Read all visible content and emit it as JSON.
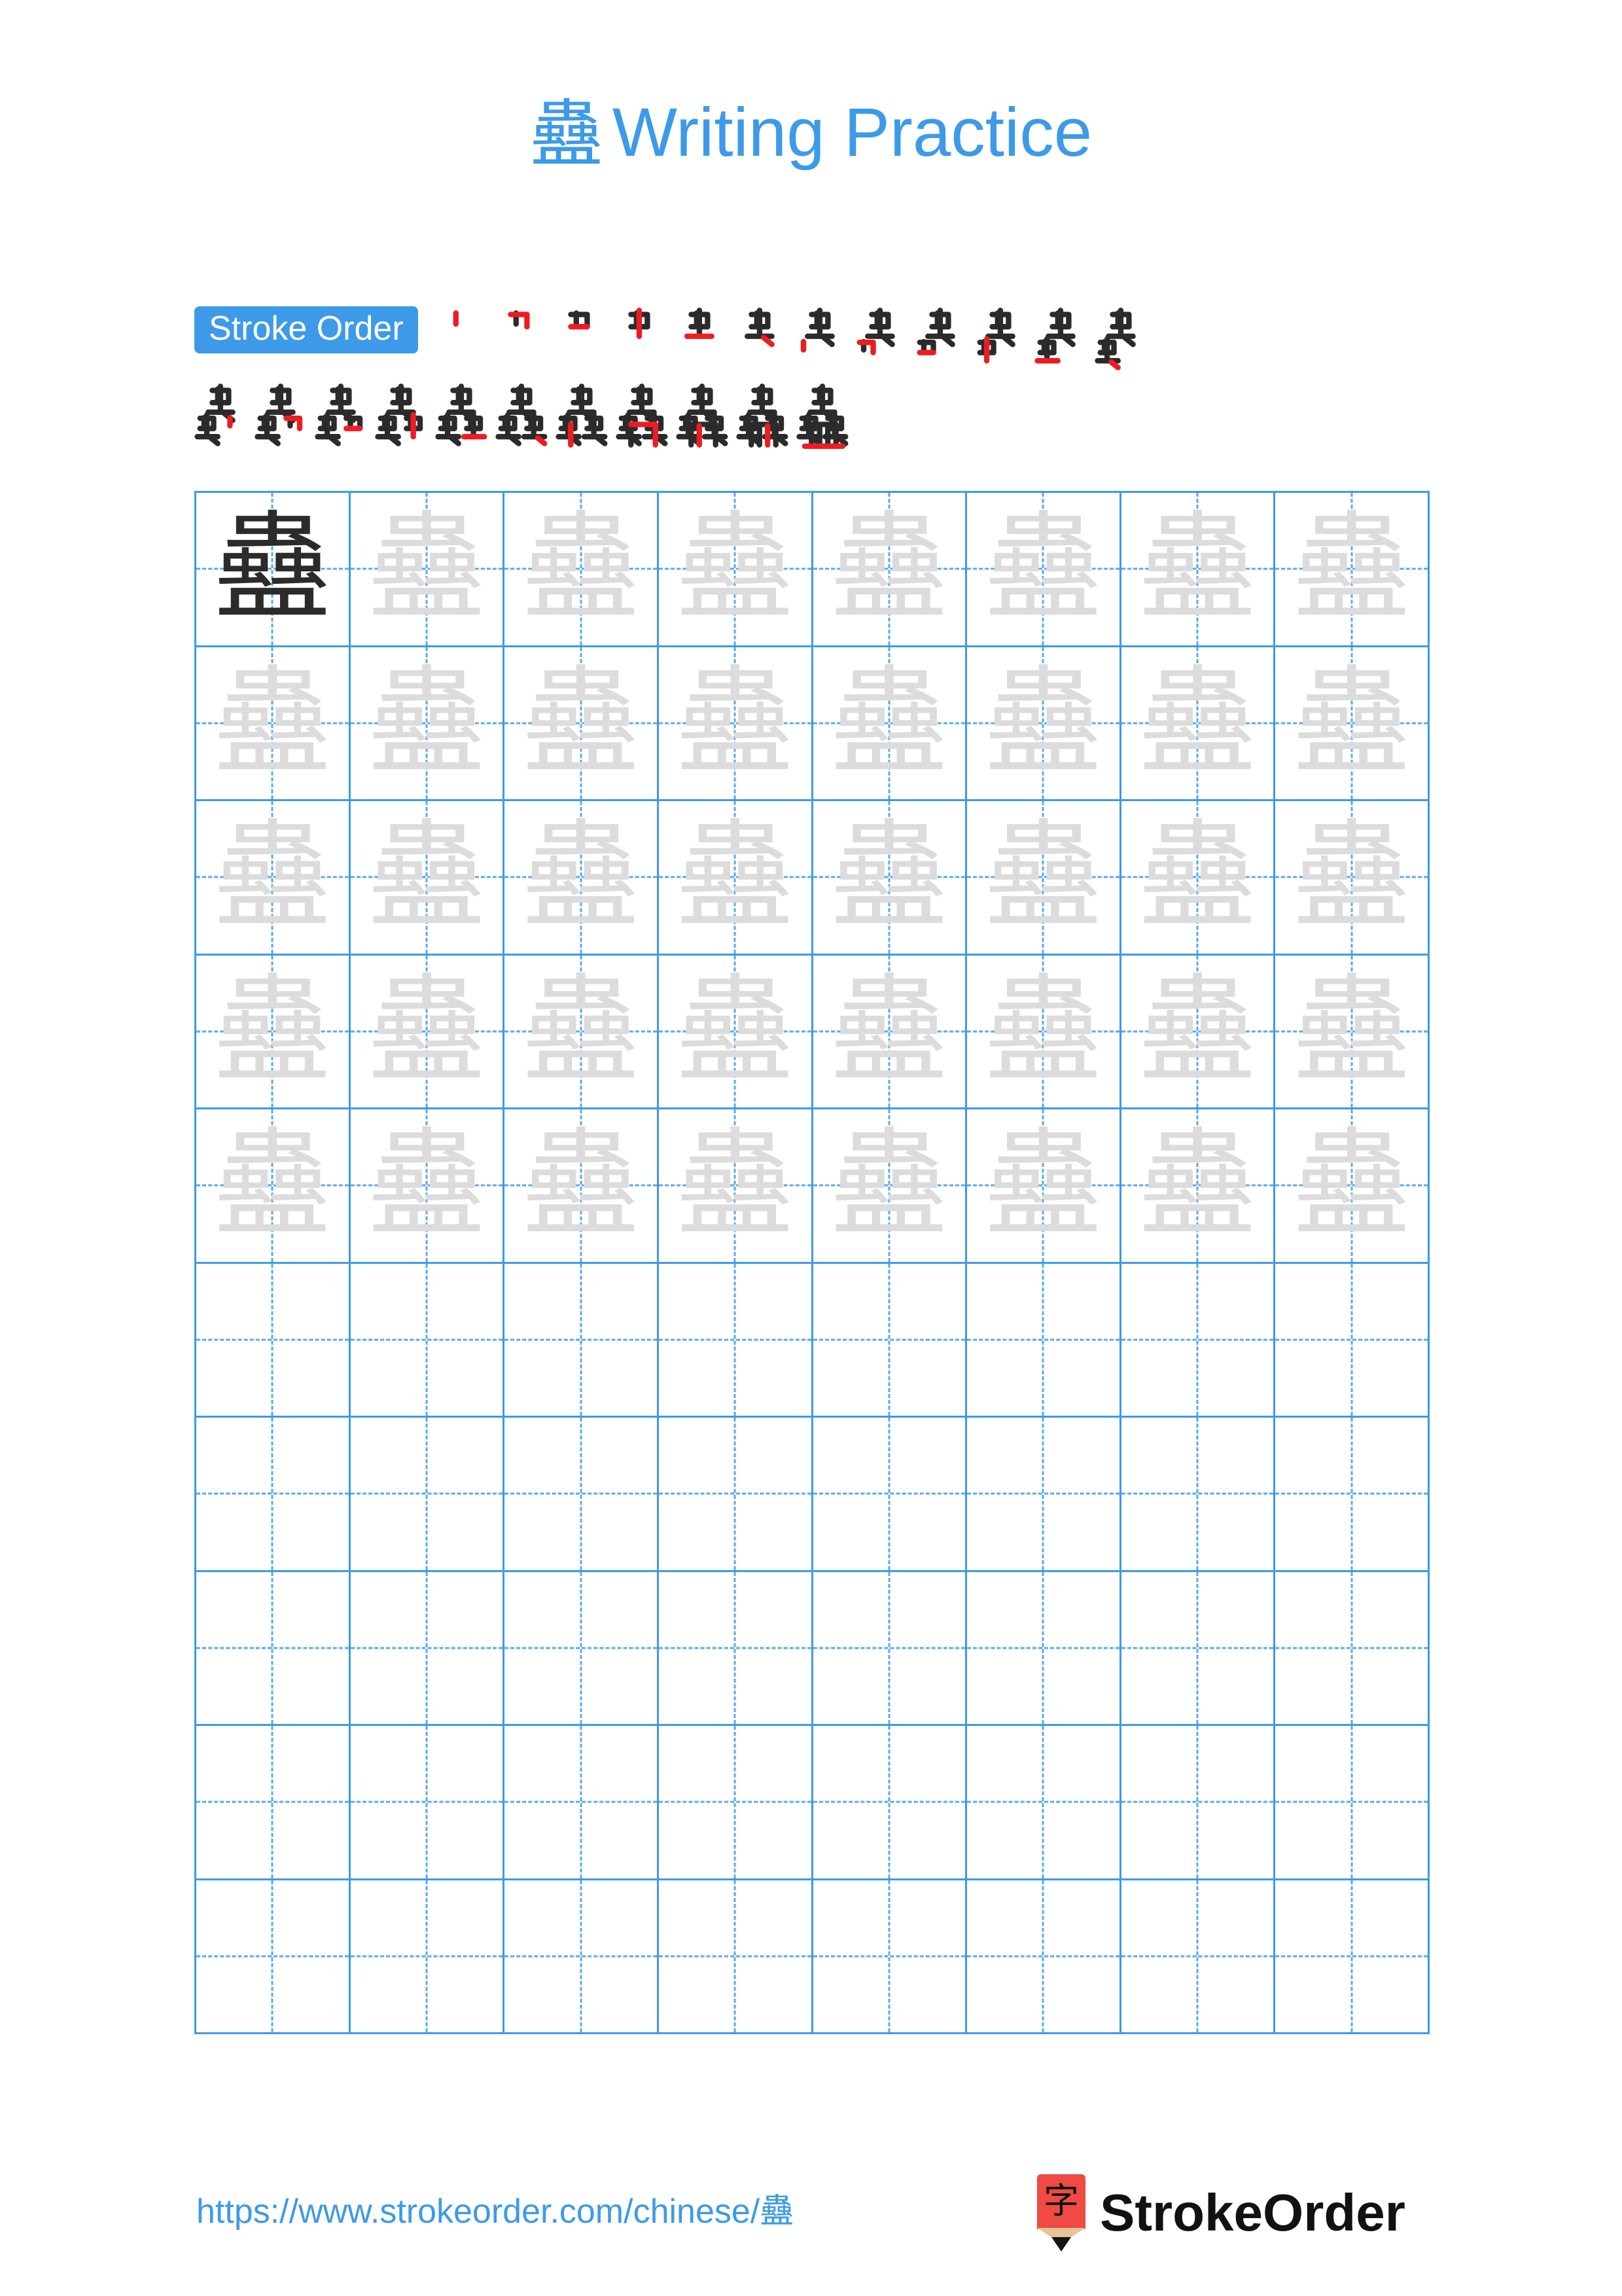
{
  "page": {
    "character": "蠱",
    "background": "#ffffff",
    "accent_color": "#3d9ae8",
    "grid_line_color": "#3d9ae8",
    "trace_color": "#dcdcdc",
    "model_color": "#2b2b2b",
    "new_stroke_color": "#ee1c22",
    "prior_stroke_color": "#2b2b2b"
  },
  "header": {
    "title_character": "蠱",
    "title_text": "Writing Practice"
  },
  "stroke_order": {
    "badge_label": "Stroke Order",
    "total_strokes": 23,
    "row1_count": 12,
    "row2_count": 11,
    "steps": [
      {
        "index": 1,
        "glyph": "丨"
      },
      {
        "index": 2,
        "glyph": "𠃍"
      },
      {
        "index": 3,
        "glyph": "口"
      },
      {
        "index": 4,
        "glyph": "中"
      },
      {
        "index": 5,
        "glyph": "虫"
      },
      {
        "index": 6,
        "glyph": "虫"
      },
      {
        "index": 7,
        "glyph": "虫"
      },
      {
        "index": 8,
        "glyph": "虫"
      },
      {
        "index": 9,
        "glyph": "虫"
      },
      {
        "index": 10,
        "glyph": "虫"
      },
      {
        "index": 11,
        "glyph": "虫"
      },
      {
        "index": 12,
        "glyph": "虫"
      },
      {
        "index": 13,
        "glyph": "蚰"
      },
      {
        "index": 14,
        "glyph": "蚰"
      },
      {
        "index": 15,
        "glyph": "蚰"
      },
      {
        "index": 16,
        "glyph": "蚰"
      },
      {
        "index": 17,
        "glyph": "蚰"
      },
      {
        "index": 18,
        "glyph": "蟲"
      },
      {
        "index": 19,
        "glyph": "蟲"
      },
      {
        "index": 20,
        "glyph": "蟲"
      },
      {
        "index": 21,
        "glyph": "蟲"
      },
      {
        "index": 22,
        "glyph": "蟲"
      },
      {
        "index": 23,
        "glyph": "蠱"
      }
    ]
  },
  "practice_grid": {
    "columns": 8,
    "rows": 10,
    "model_cells": 1,
    "trace_cells": 39,
    "blank_cells": 40,
    "cell_character": "蠱",
    "rows_data": [
      {
        "row": 1,
        "cells": [
          "model",
          "trace",
          "trace",
          "trace",
          "trace",
          "trace",
          "trace",
          "trace"
        ]
      },
      {
        "row": 2,
        "cells": [
          "trace",
          "trace",
          "trace",
          "trace",
          "trace",
          "trace",
          "trace",
          "trace"
        ]
      },
      {
        "row": 3,
        "cells": [
          "trace",
          "trace",
          "trace",
          "trace",
          "trace",
          "trace",
          "trace",
          "trace"
        ]
      },
      {
        "row": 4,
        "cells": [
          "trace",
          "trace",
          "trace",
          "trace",
          "trace",
          "trace",
          "trace",
          "trace"
        ]
      },
      {
        "row": 5,
        "cells": [
          "trace",
          "trace",
          "trace",
          "trace",
          "trace",
          "trace",
          "trace",
          "trace"
        ]
      },
      {
        "row": 6,
        "cells": [
          "blank",
          "blank",
          "blank",
          "blank",
          "blank",
          "blank",
          "blank",
          "blank"
        ]
      },
      {
        "row": 7,
        "cells": [
          "blank",
          "blank",
          "blank",
          "blank",
          "blank",
          "blank",
          "blank",
          "blank"
        ]
      },
      {
        "row": 8,
        "cells": [
          "blank",
          "blank",
          "blank",
          "blank",
          "blank",
          "blank",
          "blank",
          "blank"
        ]
      },
      {
        "row": 9,
        "cells": [
          "blank",
          "blank",
          "blank",
          "blank",
          "blank",
          "blank",
          "blank",
          "blank"
        ]
      },
      {
        "row": 10,
        "cells": [
          "blank",
          "blank",
          "blank",
          "blank",
          "blank",
          "blank",
          "blank",
          "blank"
        ]
      }
    ]
  },
  "footer": {
    "url": "https://www.strokeorder.com/chinese/蠱",
    "brand_name": "StrokeOrder",
    "logo_character": "字"
  }
}
